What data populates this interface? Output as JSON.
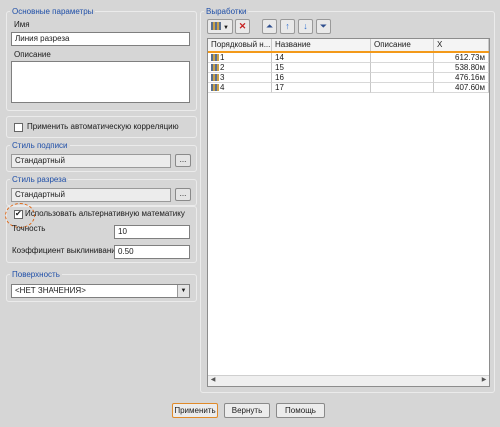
{
  "basic": {
    "legend": "Основные параметры",
    "name_label": "Имя",
    "name_value": "Линия разреза",
    "desc_label": "Описание"
  },
  "auto_correlation": {
    "label": "Применить автоматическую корреляцию",
    "checked": false
  },
  "label_style": {
    "legend": "Стиль подписи",
    "value": "Стандартный",
    "browse": "..."
  },
  "section_style": {
    "legend": "Стиль разреза",
    "value": "Стандартный",
    "browse": "..."
  },
  "alt_math": {
    "label": "Использовать альтернативную математику",
    "checked": true,
    "precision_label": "Точность",
    "precision_value": "10",
    "coef_label": "Коэффициент выклинивания",
    "coef_value": "0.50"
  },
  "surface": {
    "legend": "Поверхность",
    "value": "<НЕТ ЗНАЧЕНИЯ>"
  },
  "workings": {
    "legend": "Выработки",
    "columns": [
      "Порядковый н...",
      "Название",
      "Описание",
      "X"
    ],
    "rows": [
      {
        "order": "1",
        "name": "14",
        "desc": "",
        "x": "612.73м"
      },
      {
        "order": "2",
        "name": "15",
        "desc": "",
        "x": "538.80м"
      },
      {
        "order": "3",
        "name": "16",
        "desc": "",
        "x": "476.16м"
      },
      {
        "order": "4",
        "name": "17",
        "desc": "",
        "x": "407.60м"
      }
    ]
  },
  "buttons": {
    "apply": "Применить",
    "revert": "Вернуть",
    "help": "Помощь"
  },
  "colors": {
    "accent": "#1f4fa8",
    "highlight": "#e06a1a",
    "header_line": "#f39a1a",
    "delete": "#c62020"
  }
}
